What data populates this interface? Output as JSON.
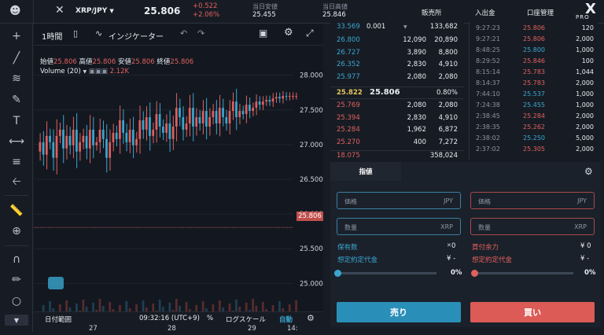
{
  "header": {
    "pair": "XRP/JPY",
    "last": "25.806",
    "change_abs": "+0.522",
    "change_pct": "+2.06%",
    "low_label": "当日安値",
    "low_value": "25.455",
    "high_label": "当日高値",
    "high_value": "25.846",
    "nav_exchange": "販売所",
    "nav_deposit": "入出金",
    "nav_account": "口座管理",
    "brand": "PRO"
  },
  "chart": {
    "interval": "1時間",
    "indicator": "インジケーター",
    "ohlc": {
      "open_label": "始値",
      "open": "25.806",
      "high_label": "高値",
      "high": "25.806",
      "low_label": "安値",
      "low": "25.806",
      "close_label": "終値",
      "close": "25.806"
    },
    "volume_label": "Volume (20)",
    "volume_value": "2.12K",
    "price_tag": "25.806",
    "y_ticks": [
      "28.000",
      "27.500",
      "27.000",
      "26.500",
      "26.000",
      "25.500",
      "25.000"
    ],
    "x_ticks": [
      "27",
      "28",
      "29",
      "14:"
    ],
    "bottom": {
      "range": "日付範囲",
      "time": "09:32:16 (UTC+9)",
      "pct": "%",
      "log": "ログスケール",
      "auto": "自動"
    }
  },
  "chart_data": {
    "type": "candlestick",
    "ylim": [
      24.8,
      28.2
    ],
    "x_ticks": [
      "27",
      "28",
      "29",
      "14:"
    ],
    "y_ticks": [
      28.0,
      27.5,
      27.0,
      26.5,
      26.0,
      25.5,
      25.0
    ],
    "last": 25.806
  },
  "book": {
    "top_price": "33.569",
    "qty_step": "0.001",
    "top_total": "133,682",
    "asks": [
      [
        "26.800",
        "12,090",
        "20,890"
      ],
      [
        "26.727",
        "3,890",
        "8,800"
      ],
      [
        "26.352",
        "2,830",
        "4,910"
      ],
      [
        "25.977",
        "2,080",
        "2,080"
      ]
    ],
    "mid_price": "25.822",
    "mid_last": "25.806",
    "mid_spread": "0.80%",
    "bids": [
      [
        "25.769",
        "2,080",
        "2,080"
      ],
      [
        "25.394",
        "2,830",
        "4,910"
      ],
      [
        "25.284",
        "1,962",
        "6,872"
      ],
      [
        "25.270",
        "400",
        "7,272"
      ]
    ],
    "bottom_price": "18.075",
    "bottom_total": "358,024"
  },
  "trades": [
    [
      "9:27:23",
      "25.806",
      "120"
    ],
    [
      "9:27:21",
      "25.806",
      "2,000"
    ],
    [
      "8:48:25",
      "25.800",
      "1,000"
    ],
    [
      "8:29:52",
      "25.846",
      "100"
    ],
    [
      "8:15:14",
      "25.783",
      "1,044"
    ],
    [
      "8:14:37",
      "25.783",
      "2,000"
    ],
    [
      "7:44:10",
      "25.537",
      "1,000"
    ],
    [
      "7:24:38",
      "25.455",
      "1,000"
    ],
    [
      "2:38:45",
      "25.284",
      "2,000"
    ],
    [
      "2:38:35",
      "25.262",
      "2,000"
    ],
    [
      "2:38:02",
      "25.250",
      "5,000"
    ],
    [
      "2:37:02",
      "25.305",
      "2,000"
    ]
  ],
  "order": {
    "tab": "指値",
    "sell_price_label": "価格",
    "sell_price_unit": "JPY",
    "sell_qty_label": "数量",
    "sell_qty_unit": "XRP",
    "buy_price_label": "価格",
    "buy_price_unit": "JPY",
    "buy_qty_label": "数量",
    "buy_qty_unit": "XRP",
    "holdings_label": "保有数",
    "holdings_value": "0",
    "sell_est_label": "想定約定代金",
    "sell_est_value": "¥ -",
    "buy_power_label": "買付余力",
    "buy_power_value": "¥ 0",
    "buy_est_label": "想定約定代金",
    "buy_est_value": "¥ -",
    "sell_slider": "0%",
    "buy_slider": "0%",
    "sell_btn": "売り",
    "buy_btn": "買い"
  },
  "colors": {
    "up": "#e0605e",
    "down": "#3aa6d0",
    "accent": "#2a8fb8"
  }
}
